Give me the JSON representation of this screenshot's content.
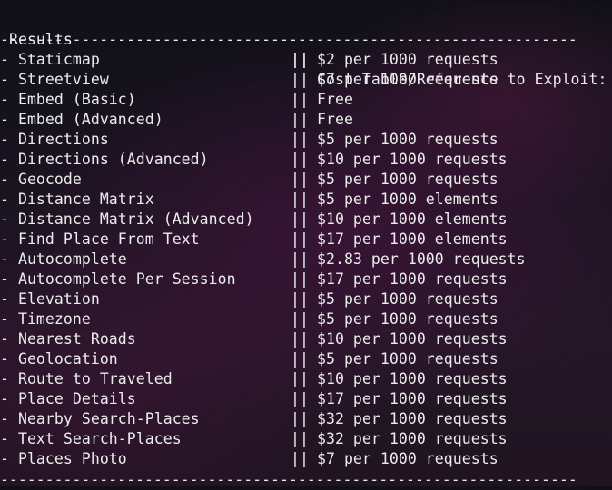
{
  "header": {
    "left": " Results",
    "separator": "||",
    "right": "Cost Table/Reference to Exploit:"
  },
  "rule": "----------------------------------------------------------------",
  "rows": [
    {
      "api": "- Staticmap",
      "cost": "$2 per 1000 requests"
    },
    {
      "api": "- Streetview",
      "cost": "$7 per 1000 requests"
    },
    {
      "api": "- Embed (Basic)",
      "cost": "Free"
    },
    {
      "api": "- Embed (Advanced)",
      "cost": "Free"
    },
    {
      "api": "- Directions",
      "cost": "$5 per 1000 requests"
    },
    {
      "api": "- Directions (Advanced)",
      "cost": "$10 per 1000 requests"
    },
    {
      "api": "- Geocode",
      "cost": "$5 per 1000 requests"
    },
    {
      "api": "- Distance Matrix",
      "cost": "$5 per 1000 elements"
    },
    {
      "api": "- Distance Matrix (Advanced)",
      "cost": "$10 per 1000 elements"
    },
    {
      "api": "- Find Place From Text",
      "cost": "$17 per 1000 elements"
    },
    {
      "api": "- Autocomplete",
      "cost": "$2.83 per 1000 requests"
    },
    {
      "api": "- Autocomplete Per Session",
      "cost": "$17 per 1000 requests"
    },
    {
      "api": "- Elevation",
      "cost": "$5 per 1000 requests"
    },
    {
      "api": "- Timezone",
      "cost": "$5 per 1000 requests"
    },
    {
      "api": "- Nearest Roads",
      "cost": "$10 per 1000 requests"
    },
    {
      "api": "- Geolocation",
      "cost": "$5 per 1000 requests"
    },
    {
      "api": "- Route to Traveled",
      "cost": "$10 per 1000 requests"
    },
    {
      "api": "- Place Details",
      "cost": "$17 per 1000 requests"
    },
    {
      "api": "- Nearby Search-Places",
      "cost": "$32 per 1000 requests"
    },
    {
      "api": "- Text Search-Places",
      "cost": "$32 per 1000 requests"
    },
    {
      "api": "- Places Photo",
      "cost": "$7 per 1000 requests"
    }
  ]
}
